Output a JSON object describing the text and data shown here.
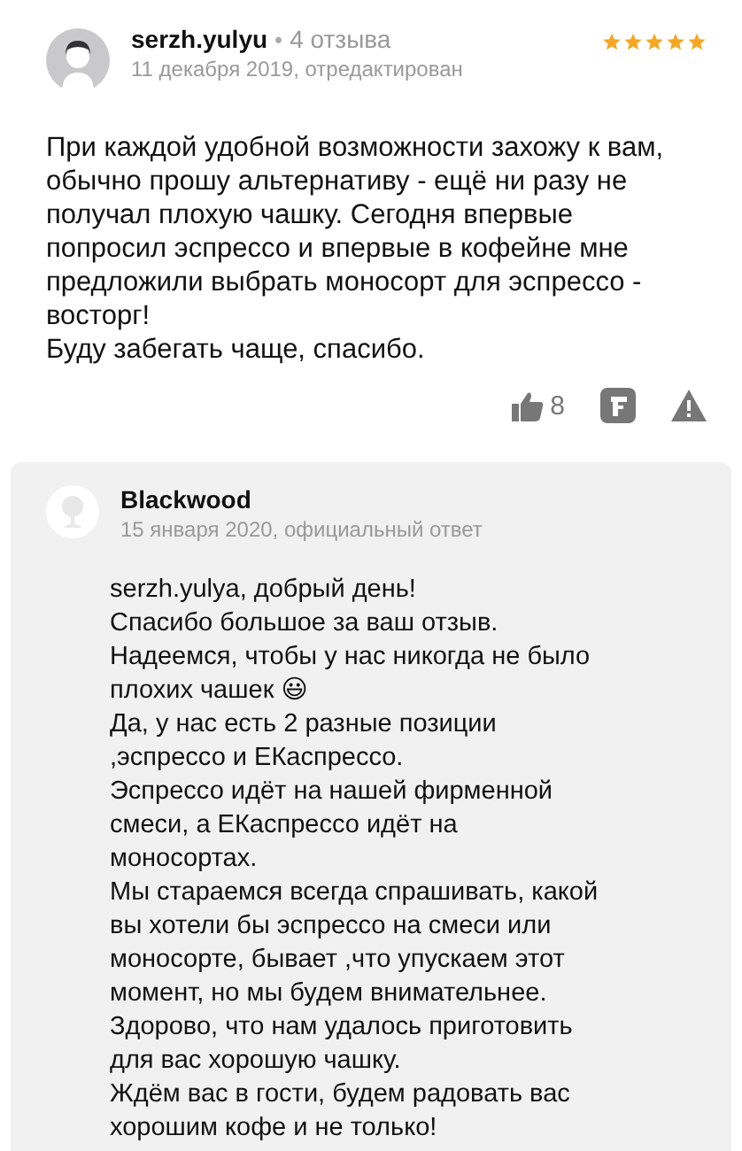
{
  "review": {
    "author": "serzh.yulyu",
    "separator": "•",
    "reviews_count": "4 отзыва",
    "stars": 5,
    "date": "11 декабря 2019, отредактирован",
    "paragraphs": [
      "При каждой удобной возможности захожу к вам, обычно прошу альтернативу - ещё ни разу не получал плохую чашку. Сегодня впервые попросил эспрессо и впервые в кофейне мне предложили выбрать моносорт для эспрессо - восторг!",
      "Буду забегать чаще, спасибо."
    ],
    "likes": "8"
  },
  "reply": {
    "author": "Blackwood",
    "date": "15 января 2020, официальный ответ",
    "paragraphs": [
      "serzh.yulya, добрый день!",
      "Спасибо большое за ваш отзыв.",
      "Надеемся, чтобы у нас никогда не было плохих чашек 😃",
      "Да, у нас есть 2 разные позиции ,эспрессо и ЕКаспрессо.",
      "Эспрессо идёт на нашей фирменной смеси, а ЕКаспрессо идёт на моносортах.",
      "Мы стараемся всегда спрашивать, какой вы хотели бы эспрессо на смеси или моносорте, бывает ,что упускаем этот момент, но мы будем внимательнее.",
      "Здорово, что нам удалось приготовить для вас хорошую чашку.",
      "Ждём вас в гости, будем радовать вас хорошим кофе и не только!"
    ]
  }
}
